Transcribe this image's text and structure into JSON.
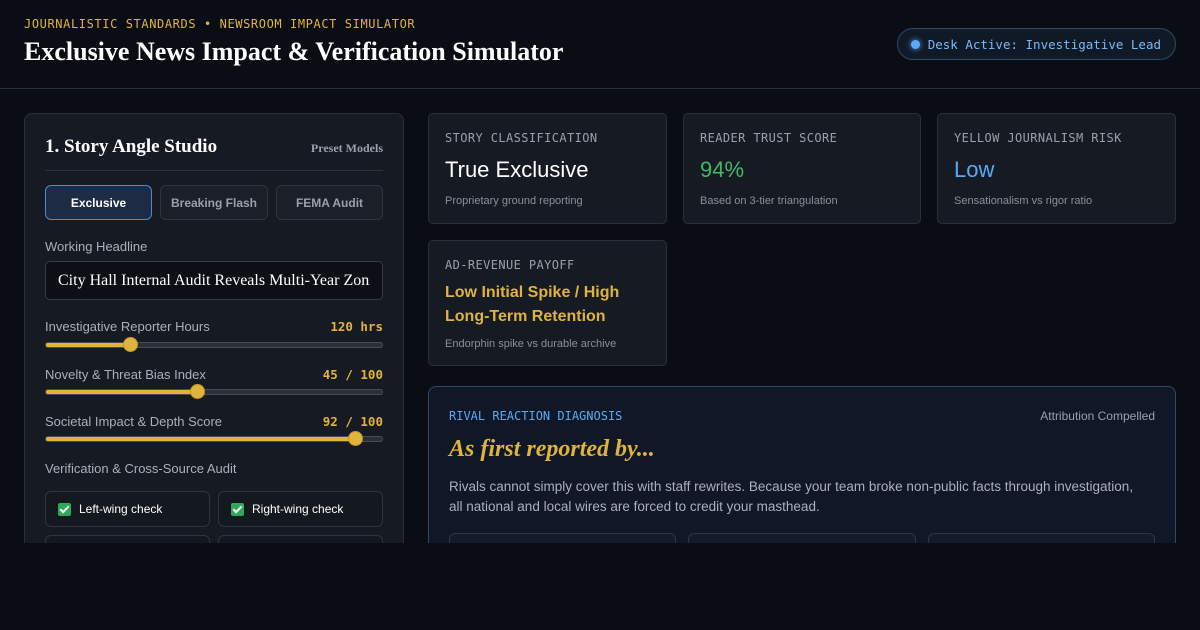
{
  "header": {
    "eyebrow": "JOURNALISTIC STANDARDS • NEWSROOM IMPACT SIMULATOR",
    "title": "Exclusive News Impact & Verification Simulator",
    "status_badge": "Desk Active: Investigative Lead"
  },
  "studio": {
    "title": "1. Story Angle Studio",
    "preset_link": "Preset Models",
    "presets": [
      {
        "label": "Exclusive",
        "active": true
      },
      {
        "label": "Breaking Flash",
        "active": false
      },
      {
        "label": "FEMA Audit",
        "active": false
      }
    ],
    "headline_label": "Working Headline",
    "headline_value": "City Hall Internal Audit Reveals Multi-Year Zoning",
    "sliders": [
      {
        "label": "Investigative Reporter Hours",
        "display": "120 hrs",
        "fraction": 0.25
      },
      {
        "label": "Novelty & Threat Bias Index",
        "display": "45 / 100",
        "fraction": 0.45
      },
      {
        "label": "Societal Impact & Depth Score",
        "display": "92 / 100",
        "fraction": 0.92
      }
    ],
    "verification_label": "Verification & Cross-Source Audit",
    "checks": [
      {
        "label": "Left-wing check",
        "checked": true
      },
      {
        "label": "Right-wing check",
        "checked": true
      }
    ]
  },
  "stats": [
    {
      "label": "Story Classification",
      "value": "True Exclusive",
      "sub": "Proprietary ground reporting",
      "color": "#ffffff"
    },
    {
      "label": "Reader Trust Score",
      "value": "94%",
      "sub": "Based on 3-tier triangulation",
      "color": "#3fb968"
    },
    {
      "label": "Yellow Journalism Risk",
      "value": "Low",
      "sub": "Sensationalism vs rigor ratio",
      "color": "#5aa9f5"
    },
    {
      "label": "Ad-Revenue Payoff",
      "value": "Low Initial Spike / High Long-Term Retention",
      "sub": "Endorphin spike vs durable archive",
      "color": "#e0b43c"
    }
  ],
  "rival": {
    "eyebrow": "RIVAL REACTION DIAGNOSIS",
    "tag": "Attribution Compelled",
    "title": "As first reported by...",
    "body": "Rivals cannot simply cover this with staff rewrites. Because your team broke non-public facts through investigation, all national and local wires are forced to credit your masthead."
  },
  "colors": {
    "accent_gold": "#e0b43c",
    "accent_blue": "#5aa9f5",
    "accent_green": "#3fb968",
    "background": "#0a0d13",
    "panel": "#161a22"
  }
}
